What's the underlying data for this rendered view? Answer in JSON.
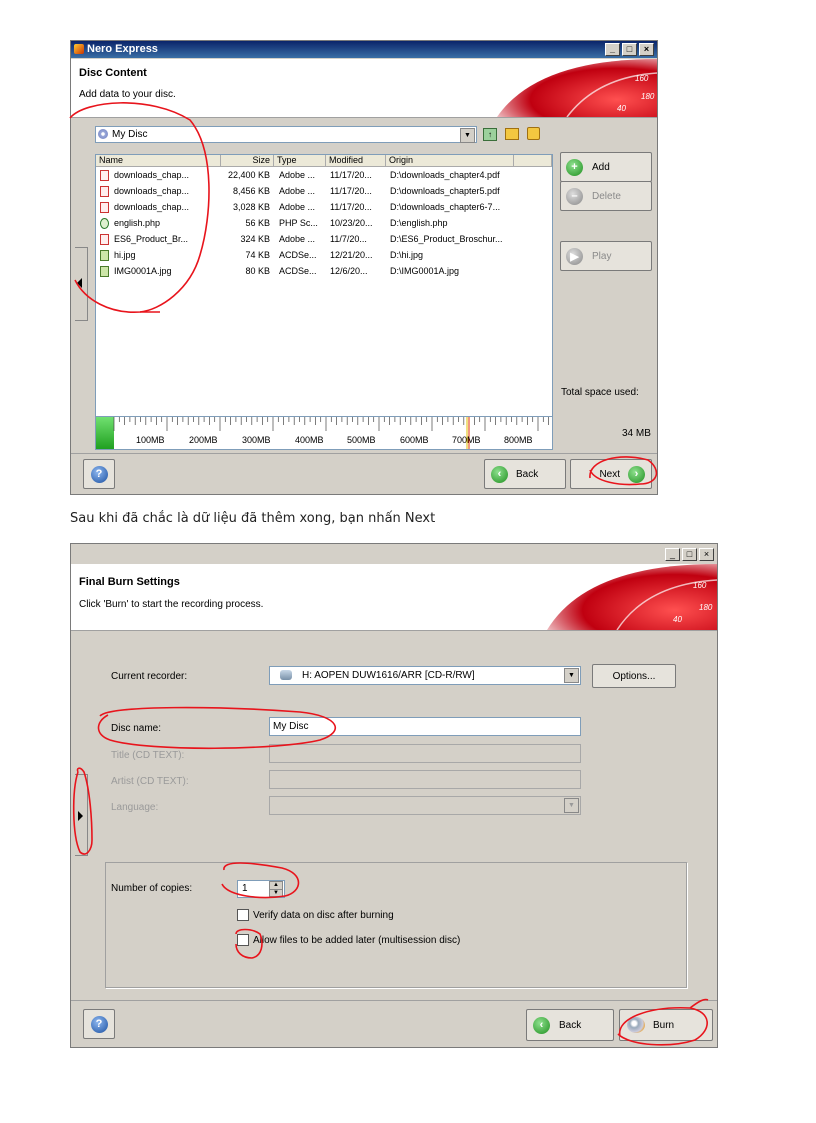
{
  "window1": {
    "title": "Nero Express",
    "header_title": "Disc Content",
    "header_subtitle": "Add data to your disc.",
    "disc_selector": "My Disc",
    "columns": [
      "Name",
      "Size",
      "Type",
      "Modified",
      "Origin"
    ],
    "files": [
      {
        "name": "downloads_chap...",
        "size": "22,400 KB",
        "type": "Adobe ...",
        "modified": "11/17/20...",
        "origin": "D:\\downloads_chapter4.pdf",
        "icon": "pdf-icon"
      },
      {
        "name": "downloads_chap...",
        "size": "8,456 KB",
        "type": "Adobe ...",
        "modified": "11/17/20...",
        "origin": "D:\\downloads_chapter5.pdf",
        "icon": "pdf-icon"
      },
      {
        "name": "downloads_chap...",
        "size": "3,028 KB",
        "type": "Adobe ...",
        "modified": "11/17/20...",
        "origin": "D:\\downloads_chapter6-7...",
        "icon": "pdf-icon"
      },
      {
        "name": "english.php",
        "size": "56 KB",
        "type": "PHP Sc...",
        "modified": "10/23/20...",
        "origin": "D:\\english.php",
        "icon": "php-icon"
      },
      {
        "name": "ES6_Product_Br...",
        "size": "324 KB",
        "type": "Adobe ...",
        "modified": "11/7/20...",
        "origin": "D:\\ES6_Product_Broschur...",
        "icon": "pdf-icon"
      },
      {
        "name": "hi.jpg",
        "size": "74 KB",
        "type": "ACDSe...",
        "modified": "12/21/20...",
        "origin": "D:\\hi.jpg",
        "icon": "image-icon"
      },
      {
        "name": "IMG0001A.jpg",
        "size": "80 KB",
        "type": "ACDSe...",
        "modified": "12/6/20...",
        "origin": "D:\\IMG0001A.jpg",
        "icon": "image-icon"
      }
    ],
    "add_label": "Add",
    "delete_label": "Delete",
    "play_label": "Play",
    "total_space_label": "Total space used:",
    "total_space_value": "34 MB",
    "ruler_labels": [
      "100MB",
      "200MB",
      "300MB",
      "400MB",
      "500MB",
      "600MB",
      "700MB",
      "800MB"
    ],
    "back_label": "Back",
    "next_label": "Next"
  },
  "caption": "Sau khi đã chắc là dữ liệu đã thêm xong, bạn nhấn Next",
  "window2": {
    "header_title": "Final Burn Settings",
    "header_subtitle": "Click 'Burn' to start the recording process.",
    "current_recorder_label": "Current recorder:",
    "current_recorder_value": "H: AOPEN DUW1616/ARR   [CD-R/RW]",
    "options_label": "Options...",
    "disc_name_label": "Disc name:",
    "disc_name_value": "My Disc",
    "title_label": "Title (CD TEXT):",
    "artist_label": "Artist (CD TEXT):",
    "language_label": "Language:",
    "copies_label": "Number of copies:",
    "copies_value": "1",
    "verify_label": "Verify data on disc after burning",
    "multisession_label": "Allow files to be added later (multisession disc)",
    "back_label": "Back",
    "burn_label": "Burn"
  },
  "colors": {
    "annotation": "#e8141c",
    "title_bar": "#0a246a",
    "dialog_bg": "#d4d0c8"
  }
}
